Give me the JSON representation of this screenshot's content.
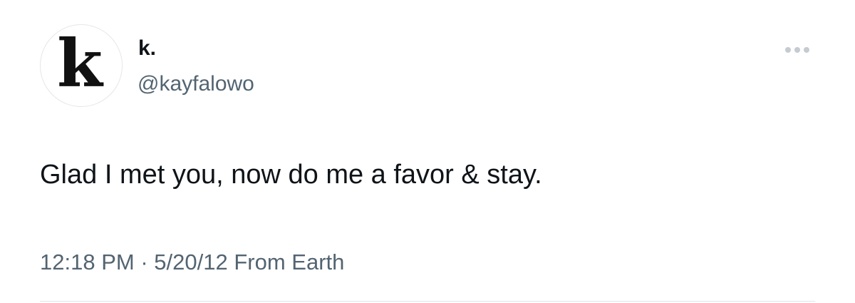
{
  "author": {
    "avatar_letter": "k",
    "display_name": "k.",
    "handle": "@kayfalowo"
  },
  "menu": {
    "icon": "more-horizontal-icon"
  },
  "tweet": {
    "text": "Glad I met you, now do me a favor & stay."
  },
  "meta": {
    "time": "12:18 PM",
    "separator": "·",
    "date": "5/20/12",
    "source": "From Earth"
  },
  "colors": {
    "text_primary": "#0f1419",
    "text_secondary": "#536471",
    "divider": "#e1e6ea"
  }
}
